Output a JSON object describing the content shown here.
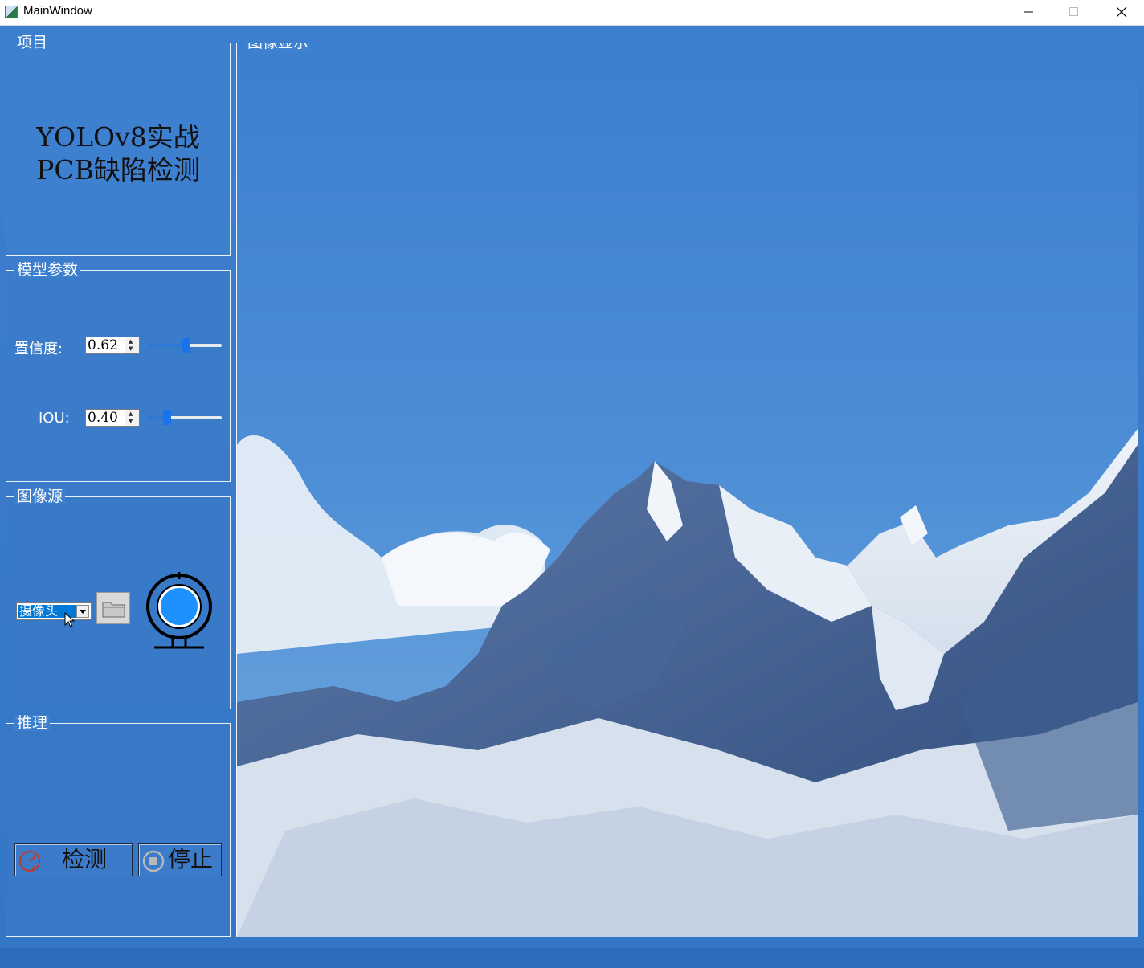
{
  "window": {
    "title": "MainWindow",
    "minimize_symbol": "—",
    "maximize_symbol": "☐",
    "close_symbol": "✕"
  },
  "project": {
    "title": "项目",
    "app_title_line1": "YOLOv8实战",
    "app_title_line2": "PCB缺陷检测"
  },
  "params": {
    "title": "模型参数",
    "confidence": {
      "label": "置信度:",
      "value": "0.62",
      "slider_fraction": 0.53
    },
    "iou": {
      "label": "IOU:",
      "value": "0.40",
      "slider_fraction": 0.28
    }
  },
  "source": {
    "title": "图像源",
    "selected": "摄像头",
    "folder_icon": "folder-icon",
    "camera_icon": "webcam-icon"
  },
  "inference": {
    "title": "推理",
    "detect_label": "检测",
    "stop_label": "停止"
  },
  "display": {
    "title": "图像显示",
    "image": "snow-mountain-landscape"
  },
  "colors": {
    "background": "#3d7fcf",
    "accent": "#0078d7",
    "slider_handle": "#1a73e8",
    "text_dark": "#111111",
    "text_light": "#ffffff"
  }
}
